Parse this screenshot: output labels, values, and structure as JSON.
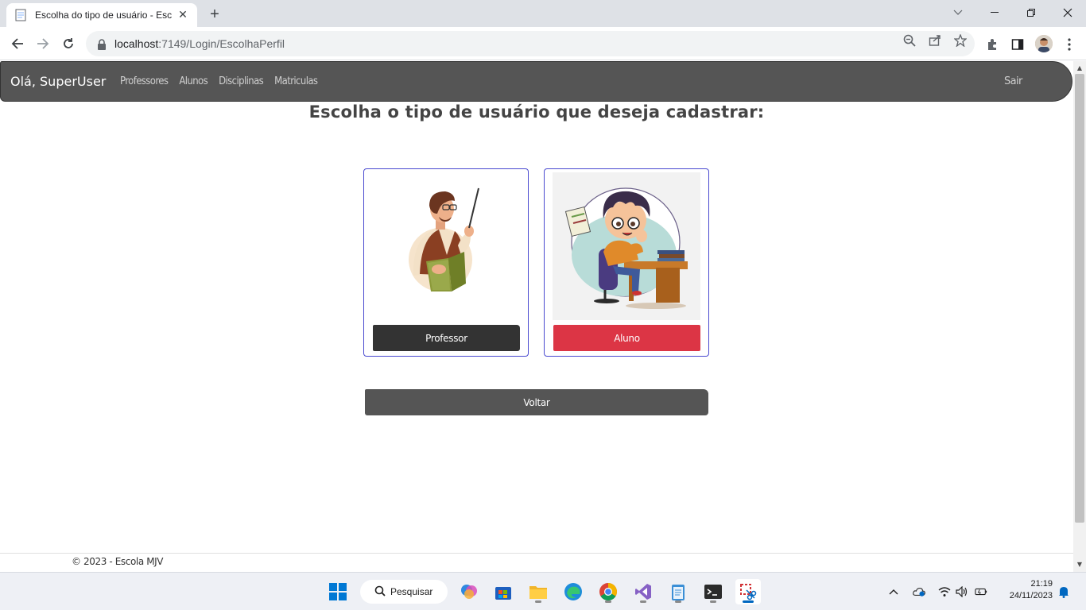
{
  "browser": {
    "tab_title": "Escolha do tipo de usuário - Esc",
    "url_host": "localhost",
    "url_path": ":7149/Login/EscolhaPerfil",
    "icons": [
      "back-icon",
      "forward-icon",
      "reload-icon",
      "lock-icon",
      "zoom-icon",
      "share-icon",
      "star-icon",
      "extensions-icon",
      "sidepanel-icon",
      "menu-icon"
    ]
  },
  "navbar": {
    "brand": "Olá, SuperUser",
    "links": [
      "Professores",
      "Alunos",
      "Disciplinas",
      "Matriculas"
    ],
    "logout": "Sair"
  },
  "page": {
    "title": "Escolha o tipo de usuário que deseja cadastrar:",
    "cards": [
      {
        "label": "Professor",
        "image": "teacher-illustration"
      },
      {
        "label": "Aluno",
        "image": "student-illustration"
      }
    ],
    "back_button": "Voltar",
    "footer": "© 2023 - Escola MJV"
  },
  "colors": {
    "navbar": "#555555",
    "professor_button": "#333333",
    "aluno_button": "#dc3545",
    "card_border": "#4a4ad0"
  },
  "taskbar": {
    "search_placeholder": "Pesquisar",
    "time": "21:19",
    "date": "24/11/2023"
  }
}
